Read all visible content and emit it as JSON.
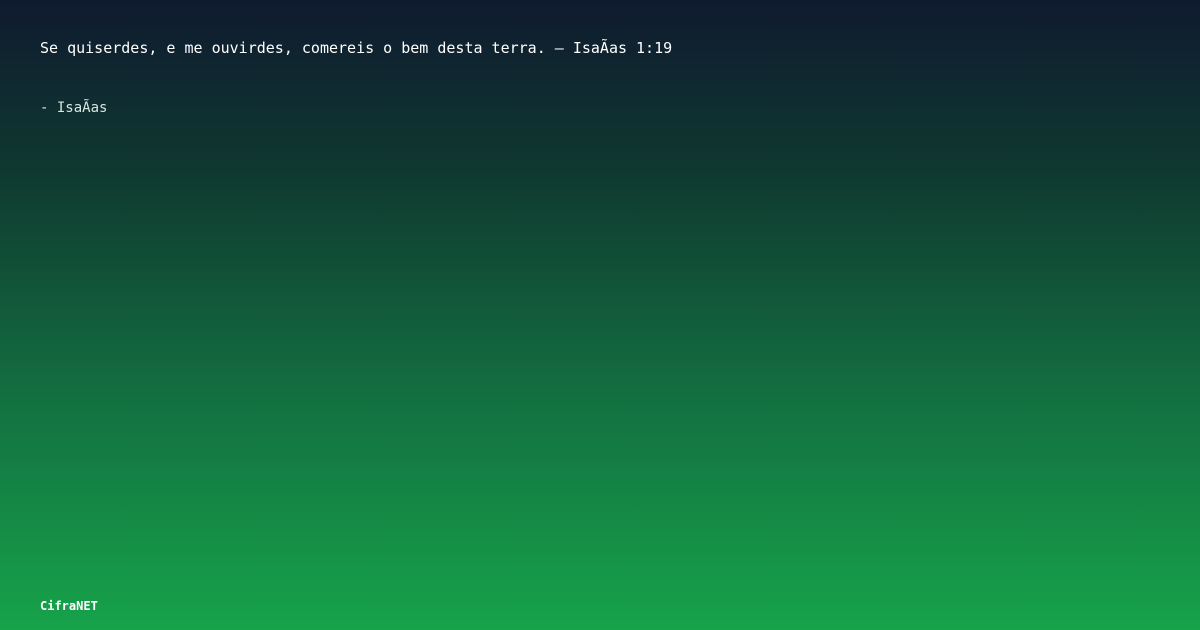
{
  "quote": {
    "text": "Se quiserdes, e me ouvirdes, comereis o bem desta terra. — IsaÃ­as 1:19"
  },
  "author": {
    "text": "- IsaÃ­as"
  },
  "brand": {
    "name": "CifraNET"
  },
  "colors": {
    "gradient_top": "#0f1a2f",
    "gradient_bottom": "#16a34a",
    "text": "#ffffff"
  }
}
